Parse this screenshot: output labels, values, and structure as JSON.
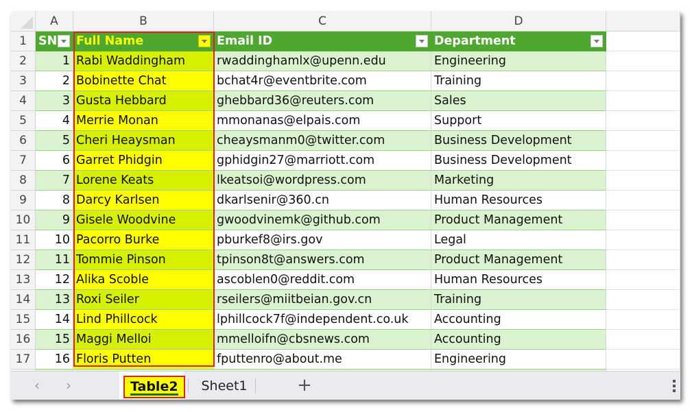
{
  "columns": [
    "A",
    "B",
    "C",
    "D"
  ],
  "row_numbers": [
    "1",
    "2",
    "3",
    "4",
    "5",
    "6",
    "7",
    "8",
    "9",
    "10",
    "11",
    "12",
    "13",
    "14",
    "15",
    "16",
    "17"
  ],
  "table": {
    "headers": [
      "SN",
      "Full Name",
      "Email ID",
      "Department"
    ],
    "rows": [
      [
        "1",
        "Rabi Waddingham",
        "rwaddinghamlx@upenn.edu",
        "Engineering"
      ],
      [
        "2",
        "Bobinette Chat",
        "bchat4r@eventbrite.com",
        "Training"
      ],
      [
        "3",
        "Gusta Hebbard",
        "ghebbard36@reuters.com",
        "Sales"
      ],
      [
        "4",
        "Merrie Monan",
        "mmonanas@elpais.com",
        "Support"
      ],
      [
        "5",
        "Cheri Heaysman",
        "cheaysmanm0@twitter.com",
        "Business Development"
      ],
      [
        "6",
        "Garret Phidgin",
        "gphidgin27@marriott.com",
        "Business Development"
      ],
      [
        "7",
        "Lorene Keats",
        "lkeatsoi@wordpress.com",
        "Marketing"
      ],
      [
        "8",
        "Darcy Karlsen",
        "dkarlsenir@360.cn",
        "Human Resources"
      ],
      [
        "9",
        "Gisele Woodvine",
        "gwoodvinemk@github.com",
        "Product Management"
      ],
      [
        "10",
        "Pacorro Burke",
        "pburkef8@irs.gov",
        "Legal"
      ],
      [
        "11",
        "Tommie Pinson",
        "tpinson8t@answers.com",
        "Product Management"
      ],
      [
        "12",
        "Alika Scoble",
        "ascoblen0@reddit.com",
        "Human Resources"
      ],
      [
        "13",
        "Roxi Seiler",
        "rseilers@miitbeian.gov.cn",
        "Training"
      ],
      [
        "14",
        "Lind Phillcock",
        "lphillcock7f@independent.co.uk",
        "Accounting"
      ],
      [
        "15",
        "Maggi Melloi",
        "mmelloifn@cbsnews.com",
        "Accounting"
      ],
      [
        "16",
        "Floris Putten",
        "fputtenro@about.me",
        "Engineering"
      ]
    ]
  },
  "tabs": {
    "prev_icon": "‹",
    "next_icon": "›",
    "sheets": [
      "Table2",
      "Sheet1"
    ],
    "active": "Table2",
    "add_icon": "+"
  },
  "colors": {
    "header_green": "#4ea72e",
    "band_green": "#daf2d0",
    "selection_yellow": "#ffff00",
    "selection_outline": "#e02020"
  }
}
